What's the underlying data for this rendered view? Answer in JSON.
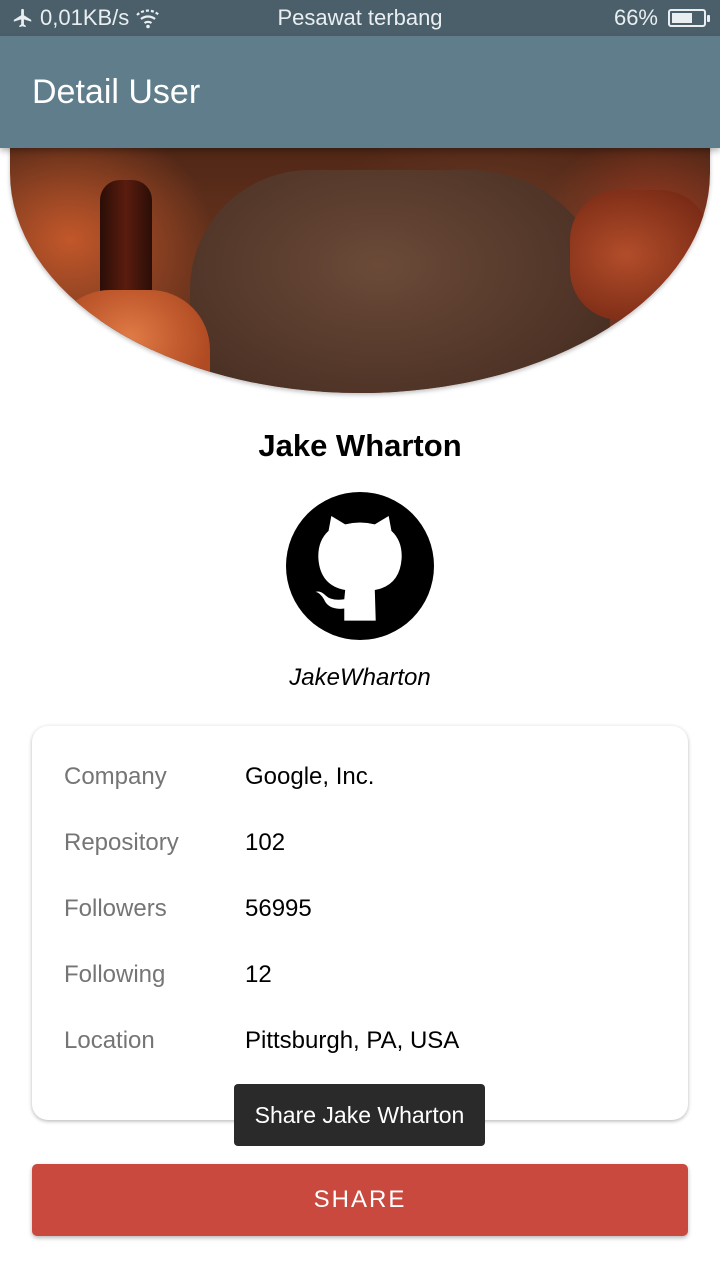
{
  "status_bar": {
    "speed": "0,01KB/s",
    "carrier": "Pesawat terbang",
    "battery": "66%",
    "battery_level": 0.66
  },
  "app_bar": {
    "title": "Detail User"
  },
  "profile": {
    "name": "Jake Wharton",
    "username": "JakeWharton",
    "avatar_icon": "github-octocat-icon"
  },
  "details": [
    {
      "label": "Company",
      "value": "Google, Inc."
    },
    {
      "label": "Repository",
      "value": "102"
    },
    {
      "label": "Followers",
      "value": "56995"
    },
    {
      "label": "Following",
      "value": "12"
    },
    {
      "label": "Location",
      "value": "Pittsburgh, PA, USA"
    }
  ],
  "toast": {
    "text": "Share Jake Wharton"
  },
  "share_button": {
    "label": "SHARE"
  },
  "colors": {
    "status_bar": "#4b5f6a",
    "app_bar": "#607d8b",
    "share_button": "#c9493f",
    "toast": "#2a2a2a"
  }
}
